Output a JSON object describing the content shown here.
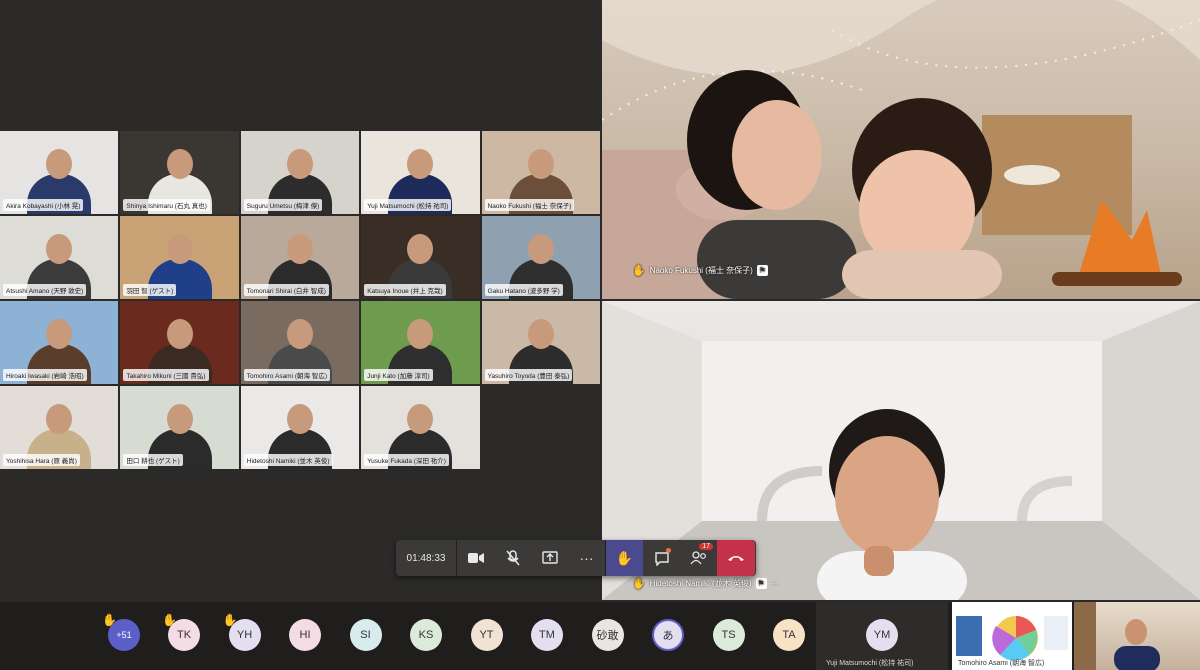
{
  "gallery": {
    "tiles": [
      {
        "name": "Akira Kobayashi (小林 晃)",
        "bg": "#e6e4e2",
        "shirt": "#2a3a6b"
      },
      {
        "name": "Shinya Ishimaru (石丸 真也)",
        "bg": "#3a3631",
        "shirt": "#e8e6e0"
      },
      {
        "name": "Suguru Umetsu (梅津 傑)",
        "bg": "#d6d2cc",
        "shirt": "#2c2c2c"
      },
      {
        "name": "Yuji Matsumochi (松持 祐司)",
        "bg": "#e9e4dc",
        "shirt": "#1d2b5a"
      },
      {
        "name": "Naoko Fukushi (福士 奈保子)",
        "bg": "#cdb9a3",
        "shirt": "#6b4f3a"
      },
      {
        "name": "Atsushi Amano (天野 敦史)",
        "bg": "#dedcd6",
        "shirt": "#3b3b3b"
      },
      {
        "name": "羽田 智 (ゲスト)",
        "bg": "#c9a276",
        "shirt": "#1f3f88"
      },
      {
        "name": "Tomonari Shirai (白井 智成)",
        "bg": "#b9a99a",
        "shirt": "#2b2b2b"
      },
      {
        "name": "Katsuya Inoue (井上 克哉)",
        "bg": "#3a2d26",
        "shirt": "#3a3a3a"
      },
      {
        "name": "Gaku Hatano (波多野 学)",
        "bg": "#8fa0b1",
        "shirt": "#2e2e2e"
      },
      {
        "name": "Hiroaki Iwasaki (岩崎 浩昭)",
        "bg": "#8eb2d6",
        "shirt": "#5a3d2b"
      },
      {
        "name": "Takahiro Mikuni (三國 貴弘)",
        "bg": "#6a2a1e",
        "shirt": "#3b2a22"
      },
      {
        "name": "Tomohiro Asami (朝海 智広)",
        "bg": "#7a6b60",
        "shirt": "#4a4a4a"
      },
      {
        "name": "Junji Kato (加藤 淳司)",
        "bg": "#6e9b4e",
        "shirt": "#2e2e2e"
      },
      {
        "name": "Yasuhiro Toyoda (豊田 泰弘)",
        "bg": "#c9b9a6",
        "shirt": "#2c2c2c"
      },
      {
        "name": "Yoshihisa Hara (原 義尚)",
        "bg": "#e2ddd6",
        "shirt": "#c7b08a"
      },
      {
        "name": "田口 耕也 (ゲスト)",
        "bg": "#d7dcd3",
        "shirt": "#2b2b2b"
      },
      {
        "name": "Hidetoshi Namiki (並木 英俊)",
        "bg": "#ebe9e7",
        "shirt": "#2b2b2b"
      },
      {
        "name": "Yusuke Fukada (深田 祐介)",
        "bg": "#e4e1dc",
        "shirt": "#2b2b2b"
      }
    ]
  },
  "spotlight": {
    "top_name": "Naoko Fukushi (福士 奈保子)",
    "bottom_name": "Hidetoshi Namiki (並木 英俊)"
  },
  "toolbar": {
    "timer": "01:48:33",
    "participants_count": "17",
    "more_glyph": "···"
  },
  "strip": {
    "overflow_label": "+51",
    "avatars": [
      {
        "initials": "TK",
        "bg": "#f3dce3",
        "hand": true
      },
      {
        "initials": "YH",
        "bg": "#e3dff0",
        "hand": true
      },
      {
        "initials": "HI",
        "bg": "#f3dce3",
        "hand": false
      },
      {
        "initials": "SI",
        "bg": "#d8ecee",
        "hand": false
      },
      {
        "initials": "KS",
        "bg": "#dcebd9",
        "hand": false
      },
      {
        "initials": "YT",
        "bg": "#f1e3d3",
        "hand": false
      },
      {
        "initials": "TM",
        "bg": "#e3dff0",
        "hand": false
      },
      {
        "initials": "砂敢",
        "bg": "#e9e6e2",
        "hand": false
      },
      {
        "initials": "あ",
        "bg": "#e3dff0",
        "hand": false
      },
      {
        "initials": "TS",
        "bg": "#dcebd9",
        "hand": false
      },
      {
        "initials": "TA",
        "bg": "#f7e2c6",
        "hand": false
      }
    ],
    "ym_initials": "YM",
    "ym_name": "Yuji Matsumochi (松持 祐司)",
    "share_name": "Tomohiro Asami (朝海 智広)"
  },
  "colors": {
    "accent": "#5b5fc7",
    "hangup": "#c4314b",
    "hand": "#f3b54a"
  },
  "icons": [
    "camera-icon",
    "mic-off-icon",
    "share-icon",
    "more-icon",
    "raise-hand-icon",
    "chat-icon",
    "people-icon",
    "hangup-icon"
  ]
}
